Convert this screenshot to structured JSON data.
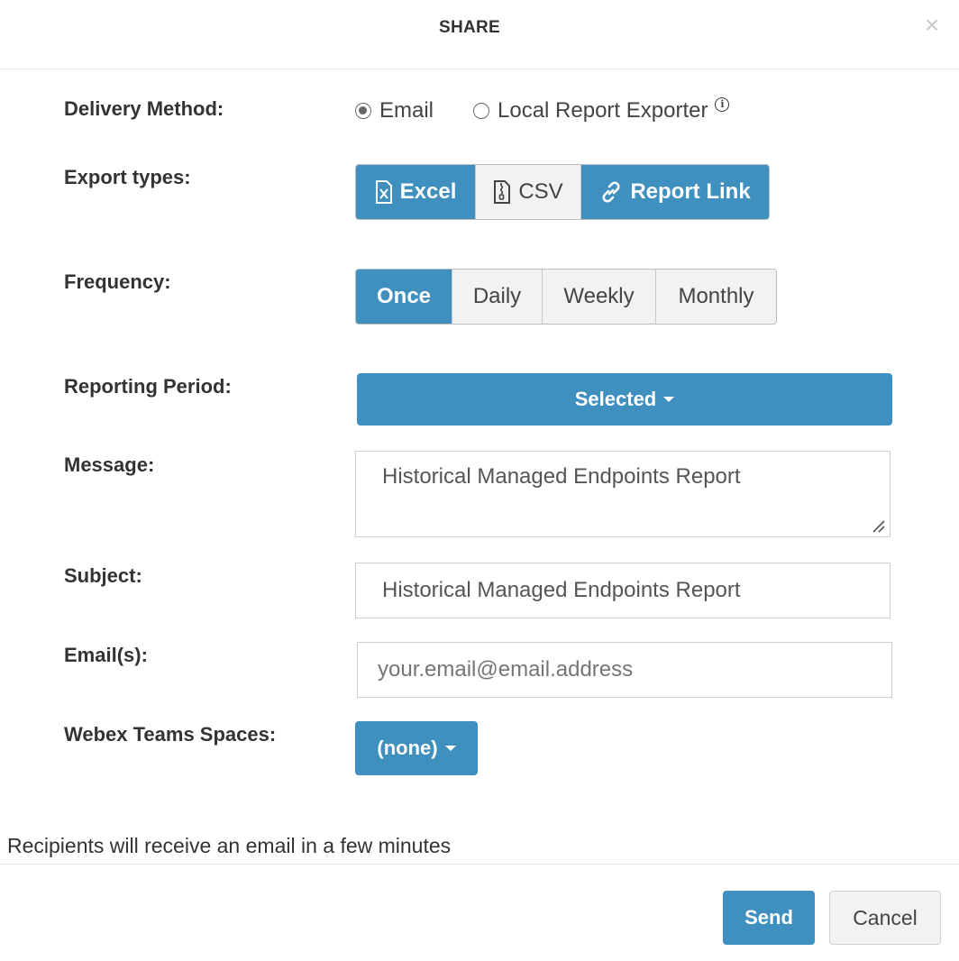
{
  "modal": {
    "title": "SHARE",
    "close_glyph": "×"
  },
  "labels": {
    "delivery_method": "Delivery Method:",
    "export_types": "Export types:",
    "frequency": "Frequency:",
    "reporting_period": "Reporting Period:",
    "message": "Message:",
    "subject": "Subject:",
    "emails": "Email(s):",
    "webex": "Webex Teams Spaces:"
  },
  "delivery": {
    "options": [
      {
        "label": "Email",
        "checked": true
      },
      {
        "label": "Local Report Exporter",
        "checked": false
      }
    ],
    "info_glyph": "i"
  },
  "export_types": [
    {
      "label": "Excel",
      "icon": "excel-file-icon",
      "active": true
    },
    {
      "label": "CSV",
      "icon": "zip-file-icon",
      "active": false
    },
    {
      "label": "Report Link",
      "icon": "link-icon",
      "active": true
    }
  ],
  "frequency": [
    {
      "label": "Once",
      "active": true
    },
    {
      "label": "Daily",
      "active": false
    },
    {
      "label": "Weekly",
      "active": false
    },
    {
      "label": "Monthly",
      "active": false
    }
  ],
  "reporting_period": {
    "value": "Selected"
  },
  "message": {
    "value": "Historical Managed Endpoints Report"
  },
  "subject": {
    "value": "Historical Managed Endpoints Report"
  },
  "emails": {
    "value": "",
    "placeholder": "your.email@email.address"
  },
  "webex": {
    "value": "(none)"
  },
  "footer": {
    "note": "Recipients will receive an email in a few minutes",
    "send_label": "Send",
    "cancel_label": "Cancel"
  },
  "colors": {
    "accent": "#3f8fbf",
    "segment_bg": "#f2f2f2",
    "border": "#cfcfcf"
  }
}
